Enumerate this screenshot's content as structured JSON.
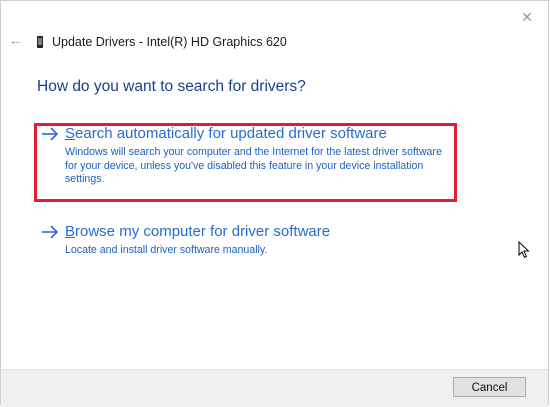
{
  "window": {
    "title": "Update Drivers - Intel(R) HD Graphics 620",
    "close_glyph": "✕",
    "back_glyph": "←"
  },
  "heading": "How do you want to search for drivers?",
  "options": [
    {
      "access_key": "S",
      "title_rest": "earch automatically for updated driver software",
      "description": "Windows will search your computer and the Internet for the latest driver software for your device, unless you've disabled this feature in your device installation settings.",
      "highlighted": true
    },
    {
      "access_key": "B",
      "title_rest": "rowse my computer for driver software",
      "description": "Locate and install driver software manually.",
      "highlighted": false
    }
  ],
  "footer": {
    "cancel_label": "Cancel"
  },
  "colors": {
    "accent": "#2a6bd0",
    "heading": "#1c3f8c",
    "highlight": "#e0202e"
  },
  "icons": {
    "back": "back-arrow-icon",
    "close": "close-icon",
    "device": "graphics-device-icon",
    "option_arrow": "right-arrow-icon",
    "cursor": "mouse-pointer-icon"
  }
}
